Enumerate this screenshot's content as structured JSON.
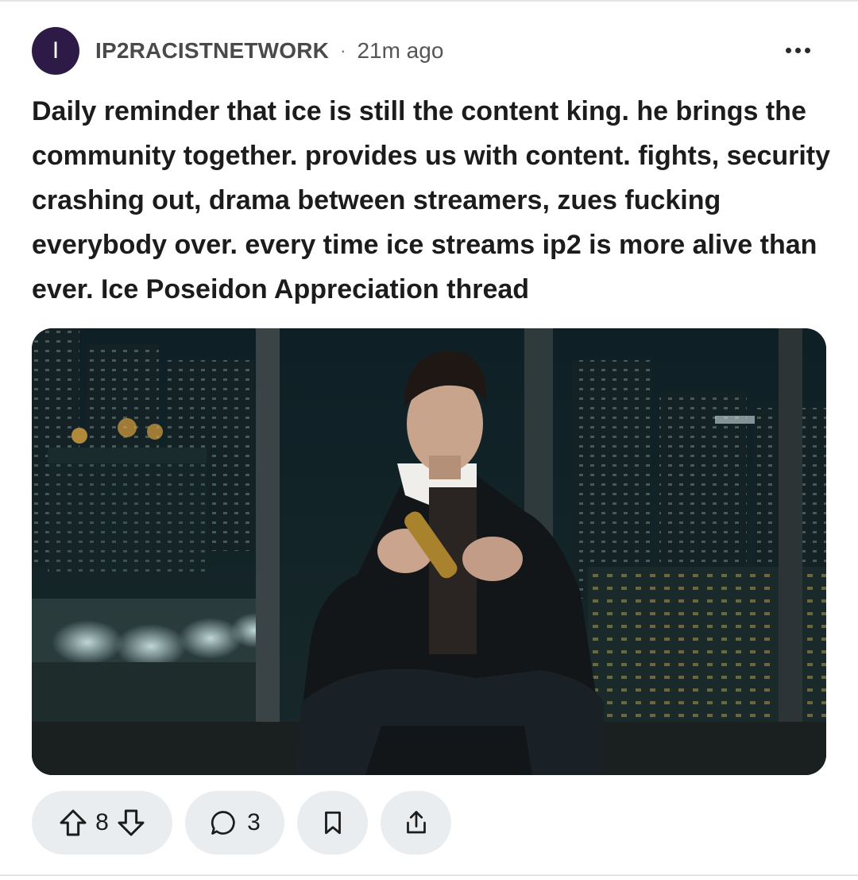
{
  "post": {
    "avatar_letter": "I",
    "author": "IP2RACISTNETWORK",
    "separator": "·",
    "time": "21m ago",
    "title": "Daily reminder that ice is still the content king. he brings the community together. provides us with content. fights, security crashing out, drama between streamers, zues fucking everybody over. every time ice streams ip2 is more alive than ever. Ice Poseidon Appreciation thread",
    "upvotes": "8",
    "comments": "3"
  },
  "icons": {
    "more": "more-options-icon",
    "upvote": "upvote-arrow-icon",
    "downvote": "downvote-arrow-icon",
    "comment": "comment-bubble-icon",
    "save": "bookmark-icon",
    "share": "share-icon"
  },
  "colors": {
    "avatar_bg": "#2e1a47",
    "pill_bg": "#eaedef",
    "text": "#1c1c1c"
  }
}
